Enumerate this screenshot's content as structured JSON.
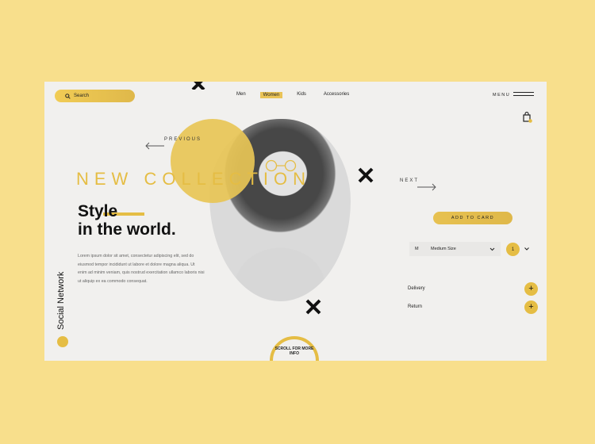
{
  "header": {
    "search_placeholder": "Search",
    "nav": [
      "Men",
      "Women",
      "Kids",
      "Accessories"
    ],
    "nav_active": "Women",
    "menu_label": "MENU"
  },
  "hero": {
    "collection_title": "NEW COLLECTION",
    "prev_label": "PREVIOUS",
    "next_label": "NEXT",
    "headline_line1": "Style",
    "headline_line2": "in the world.",
    "body_lines": [
      "Lorem ipsum dolor sit amet, consectetur adipiscing elit, sed do",
      "eiusmod tempor incididunt ut labore et dolore magna aliqua. Ut",
      "enim ad minim veniam, quis nostrud exercitation ullamco laboris nisi",
      "ut aliquip ex ea commodo consequat."
    ],
    "social_label": "Social Network",
    "scroll_label_line1": "SCROLL FOR MORE",
    "scroll_label_line2": "INFO"
  },
  "product": {
    "add_button": "ADD TO CARD",
    "size_code": "M",
    "size_value": "Medium Size",
    "quantity": "1",
    "delivery_label": "Delivery",
    "return_label": "Return",
    "plus": "+"
  },
  "colors": {
    "page_bg": "#f8df8c",
    "card_bg": "#f1f0ee",
    "accent": "#e5bd44"
  }
}
